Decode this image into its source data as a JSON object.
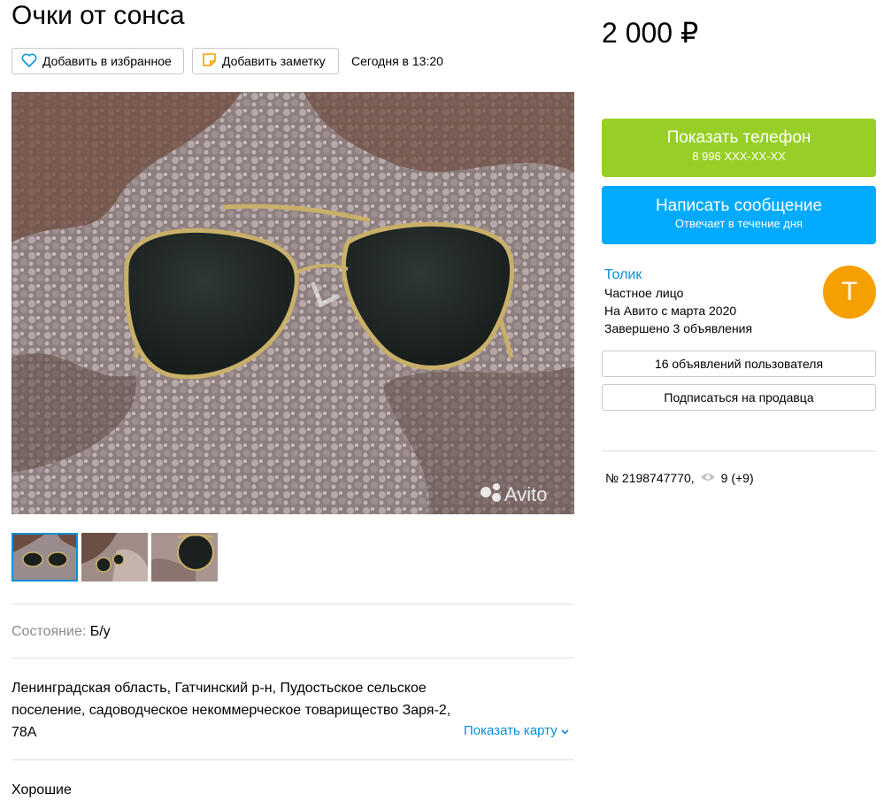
{
  "title": "Очки от сонса",
  "actions": {
    "favorite": "Добавить в избранное",
    "note": "Добавить заметку",
    "date": "Сегодня в 13:20"
  },
  "price": "2 000 ₽",
  "phone_button": {
    "label": "Показать телефон",
    "sub": "8 996 XXX-XX-XX",
    "color": "#97cf26"
  },
  "message_button": {
    "label": "Написать сообщение",
    "sub": "Отвечает в течение дня",
    "color": "#00aaff"
  },
  "seller": {
    "name": "Толик",
    "type": "Частное лицо",
    "since": "На Авито с марта 2020",
    "completed": "Завершено 3 объявления",
    "avatar_letter": "Т",
    "avatar_color": "#f5a000"
  },
  "seller_buttons": {
    "listings": "16 объявлений пользователя",
    "subscribe": "Подписаться на продавца"
  },
  "listing_stats": {
    "number": "№ 2198747770,",
    "views": "9 (+9)"
  },
  "watermark": "Avito",
  "condition": {
    "label": "Состояние:",
    "value": "Б/у"
  },
  "address": "Ленинградская область, Гатчинский р-н, Пудостьское сельское поселение, садоводческое некоммерческое товарищество Заря-2, 78А",
  "show_map": "Показать карту",
  "description": "Хорошие"
}
